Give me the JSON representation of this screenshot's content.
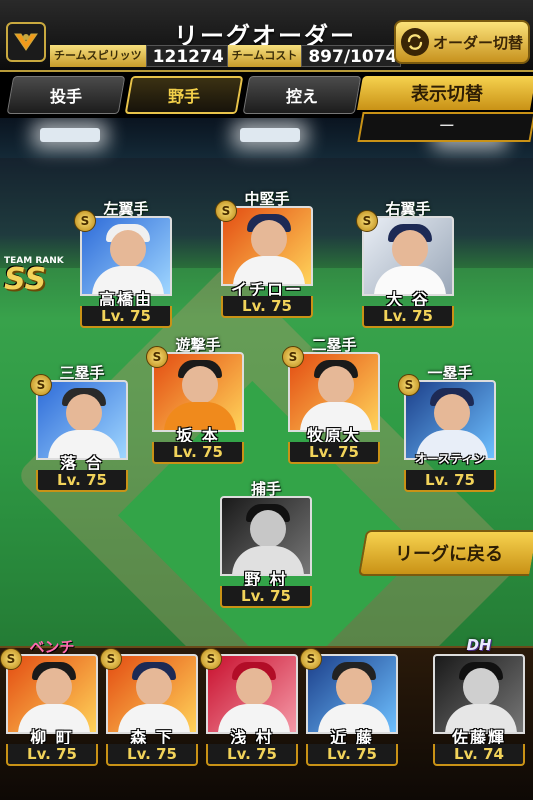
{
  "header": {
    "title": "リーグオーダー",
    "team_spirits_label": "チームスピリッツ",
    "team_spirits_value": "121274",
    "team_cost_label": "チームコスト",
    "team_cost_value": "897/1074",
    "order_switch_label": "オーダー切替"
  },
  "tabs": [
    {
      "label": "投手",
      "active": false
    },
    {
      "label": "野手",
      "active": true
    },
    {
      "label": "控え",
      "active": false
    }
  ],
  "view_toggle": {
    "label": "表示切替",
    "value": "－"
  },
  "team_rank": {
    "label": "TEAM RANK",
    "value": "SS"
  },
  "back_button": {
    "label": "リーグに戻る"
  },
  "badge_text": "S",
  "fielders": [
    {
      "position": "左翼手",
      "name": "高橋由",
      "level": "Lv. 75",
      "theme": "bg-blue"
    },
    {
      "position": "中堅手",
      "name": "イチロー",
      "level": "Lv. 75",
      "theme": "bg-fire"
    },
    {
      "position": "右翼手",
      "name": "大 谷",
      "level": "Lv. 75",
      "theme": "bg-white"
    },
    {
      "position": "三塁手",
      "name": "落 合",
      "level": "Lv. 75",
      "theme": "bg-blue"
    },
    {
      "position": "遊撃手",
      "name": "坂 本",
      "level": "Lv. 75",
      "theme": "bg-fire"
    },
    {
      "position": "二塁手",
      "name": "牧原大",
      "level": "Lv. 75",
      "theme": "bg-fire"
    },
    {
      "position": "一塁手",
      "name": "オースティン",
      "level": "Lv. 75",
      "theme": "bg-night"
    },
    {
      "position": "捕手",
      "name": "野 村",
      "level": "Lv. 75",
      "theme": "bg-dark"
    }
  ],
  "bench": {
    "label": "ベンチ",
    "dh_label": "DH",
    "players": [
      {
        "name": "柳 町",
        "level": "Lv. 75",
        "theme": "bg-fire"
      },
      {
        "name": "森 下",
        "level": "Lv. 75",
        "theme": "bg-fire"
      },
      {
        "name": "浅 村",
        "level": "Lv. 75",
        "theme": "bg-red"
      },
      {
        "name": "近 藤",
        "level": "Lv. 75",
        "theme": "bg-night"
      },
      {
        "name": "佐藤輝",
        "level": "Lv. 74",
        "theme": "bg-dark"
      }
    ]
  }
}
